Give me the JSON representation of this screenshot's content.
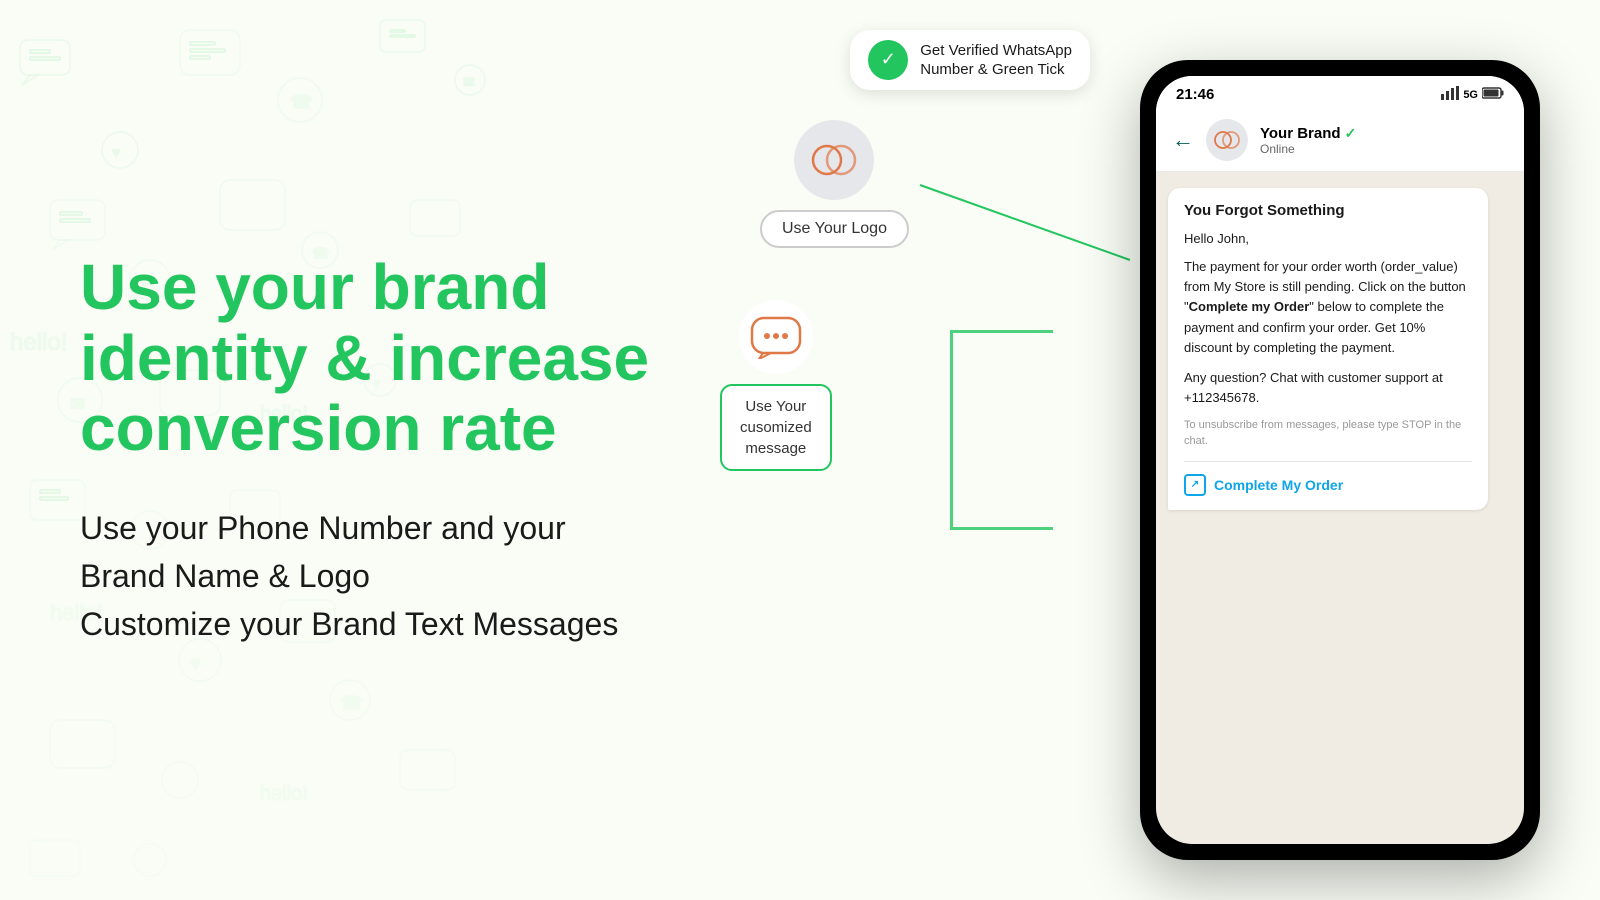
{
  "headline": "Use your brand identity & increase conversion rate",
  "subtext_line1": "Use your Phone Number and your",
  "subtext_line2": "Brand Name & Logo",
  "subtext_line3": "Customize your Brand Text Messages",
  "verified_badge": {
    "text_line1": "Get Verified WhatsApp",
    "text_line2": "Number & Green Tick"
  },
  "use_logo_label": "Use Your Logo",
  "use_msg_label_line1": "Use Your",
  "use_msg_label_line2": "cusomized",
  "use_msg_label_line3": "message",
  "phone": {
    "time": "21:46",
    "signal": "5G",
    "contact_name": "Your Brand",
    "contact_status": "Online",
    "back_arrow": "←",
    "message": {
      "title": "You Forgot Something",
      "greeting": "Hello John,",
      "body_line1": "The payment for your order worth (order_value) from My Store is still pending. Click on the button \"",
      "body_bold": "Complete my Order",
      "body_line2": "\" below to complete the payment and confirm your order. Get 10% discount by completing the payment.",
      "support_text": "Any question? Chat with customer support at +112345678.",
      "unsubscribe": "To unsubscribe from messages, please type STOP in the chat.",
      "cta_label": "Complete My Order"
    }
  }
}
